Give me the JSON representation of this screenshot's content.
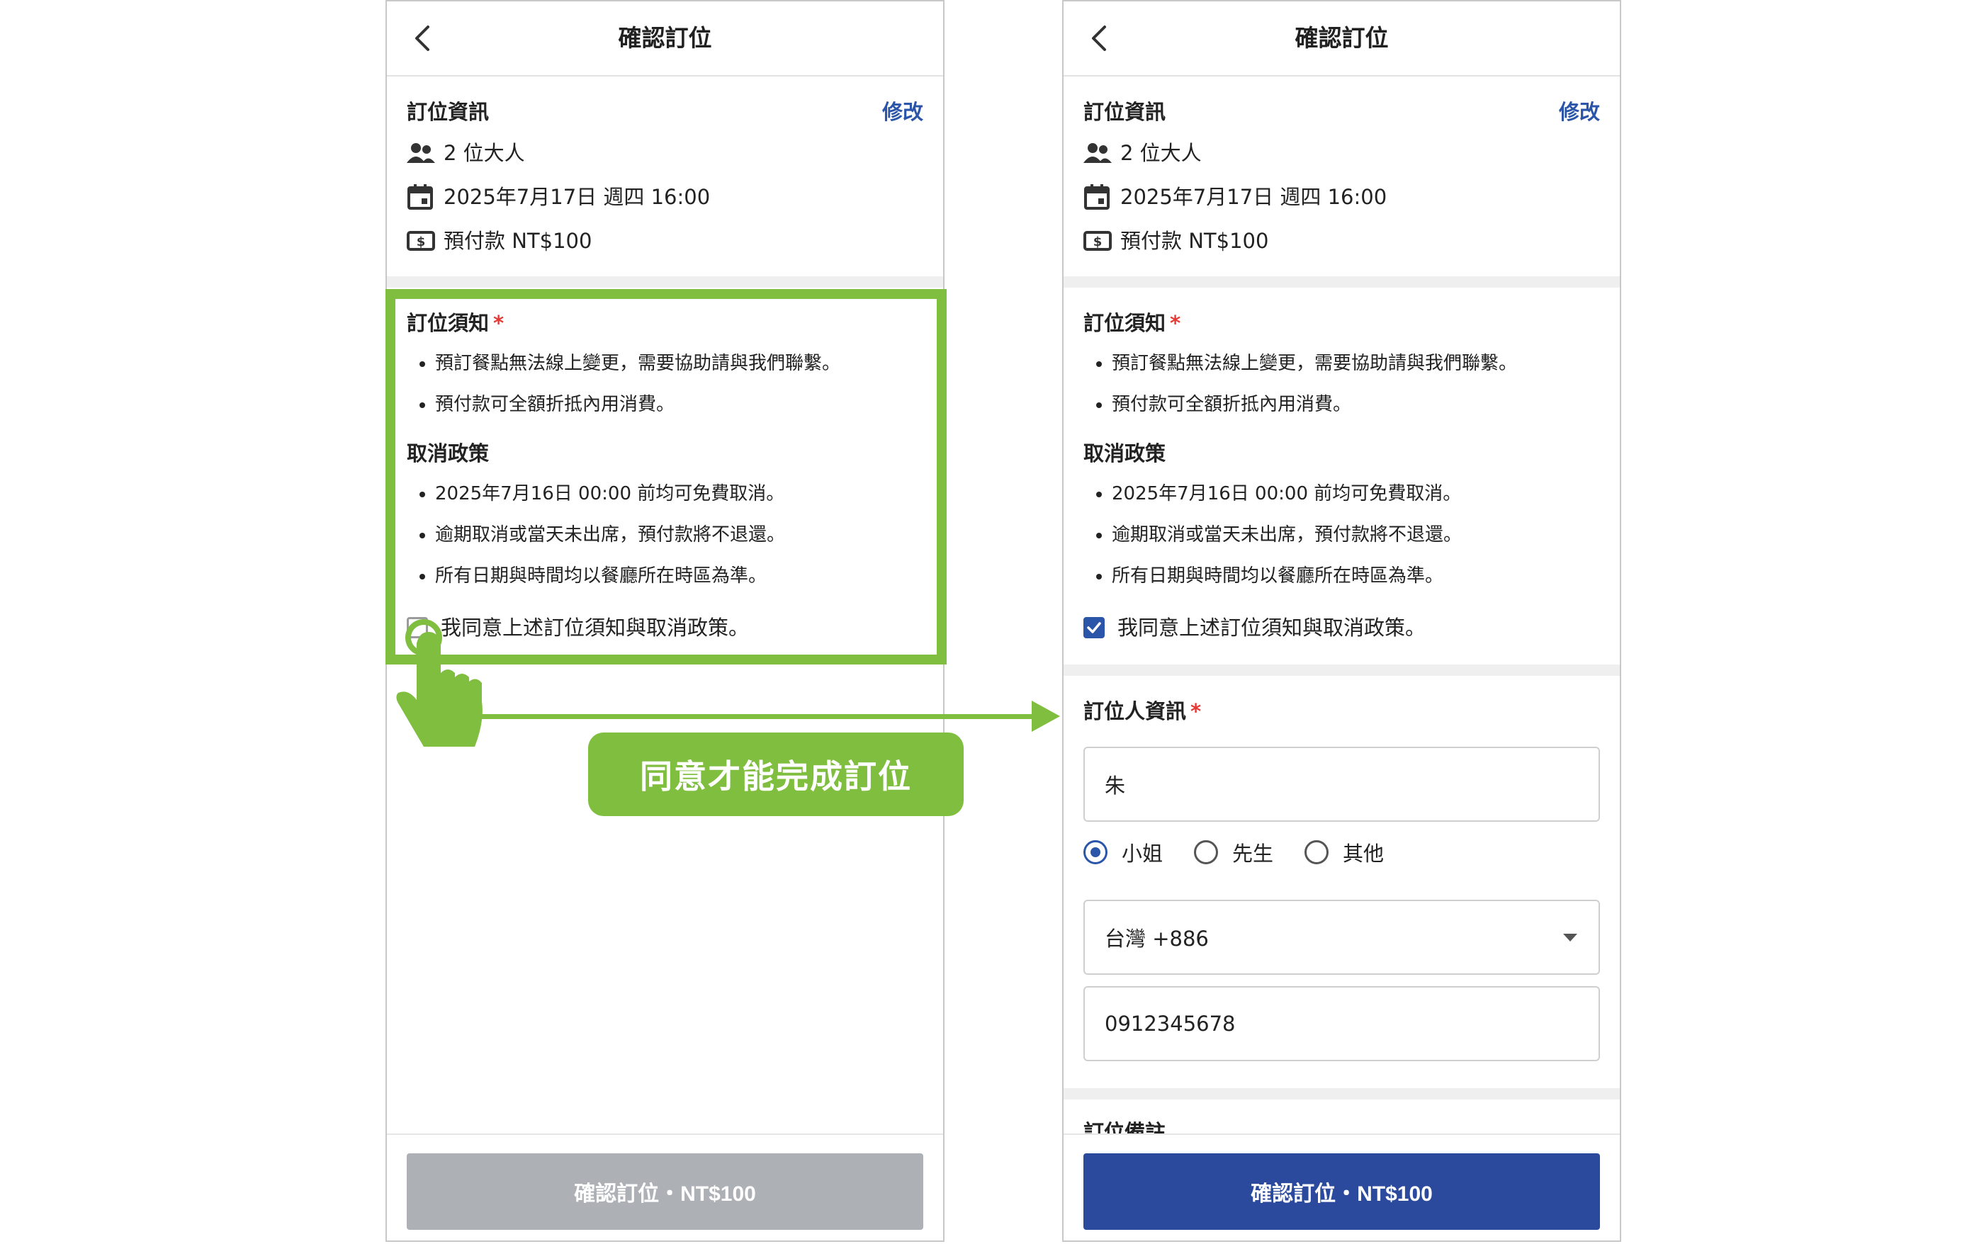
{
  "header": {
    "title": "確認訂位",
    "back_icon": "chevron-left-icon"
  },
  "booking": {
    "section_title": "訂位資訊",
    "edit_label": "修改",
    "guests": "2 位大人",
    "datetime": "2025年7月17日 週四 16:00",
    "deposit": "預付款 NT$100"
  },
  "notice": {
    "title": "訂位須知",
    "required_mark": "*",
    "items": [
      "預訂餐點無法線上變更，需要協助請與我們聯繫。",
      "預付款可全額折抵內用消費。"
    ]
  },
  "cancel_policy": {
    "title": "取消政策",
    "items": [
      "2025年7月16日 00:00 前均可免費取消。",
      "逾期取消或當天未出席，預付款將不退還。",
      "所有日期與時間均以餐廳所在時區為準。"
    ]
  },
  "agree": {
    "label": "我同意上述訂位須知與取消政策。"
  },
  "left_state": {
    "agree_checked": false,
    "cta_enabled": false
  },
  "right_state": {
    "agree_checked": true,
    "cta_enabled": true
  },
  "contact": {
    "title": "訂位人資訊",
    "required_mark": "*",
    "name_value": "朱",
    "salutation_options": [
      "小姐",
      "先生",
      "其他"
    ],
    "salutation_selected": "小姐",
    "country_code": "台灣 +886",
    "phone_value": "0912345678"
  },
  "next_section_partial": "訂位備註",
  "cta_label": "確認訂位・NT$100",
  "annotation": {
    "callout": "同意才能完成訂位",
    "accent_color": "#7fbe3e"
  },
  "colors": {
    "primary": "#2b4a9e",
    "link": "#2b55a8",
    "disabled": "#adb0b5",
    "required": "#e53935"
  }
}
